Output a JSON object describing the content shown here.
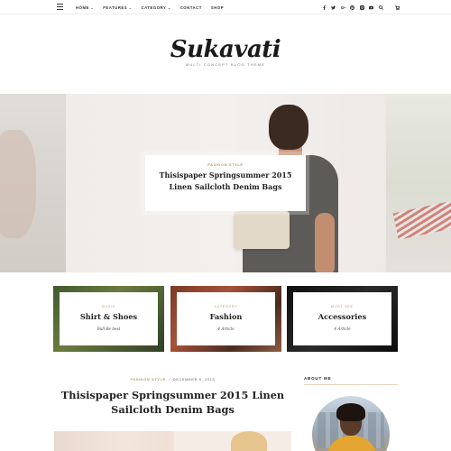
{
  "nav": {
    "items": [
      {
        "label": "Home",
        "has_dropdown": true
      },
      {
        "label": "Features",
        "has_dropdown": true
      },
      {
        "label": "Category",
        "has_dropdown": true
      },
      {
        "label": "Contact",
        "has_dropdown": false
      },
      {
        "label": "Shop",
        "has_dropdown": false
      }
    ],
    "caret": "⌄",
    "social_icons": [
      "facebook-icon",
      "twitter-icon",
      "google-plus-icon",
      "pinterest-icon",
      "instagram-icon",
      "youtube-icon",
      "search-icon"
    ],
    "cart_icon": "cart-icon"
  },
  "logo": {
    "name": "Sukavati",
    "tagline": "Multi Concept Blog Theme"
  },
  "hero": {
    "category": "Fashion Style",
    "title_line1": "Thisispaper Springsummer 2015",
    "title_line2": "Linen Sailcloth Denim Bags"
  },
  "categories": [
    {
      "label": "Music",
      "name": "Shirt & Shoes",
      "count": "Bull Be best"
    },
    {
      "label": "Category",
      "name": "Fashion",
      "count": "4 Article"
    },
    {
      "label": "Must See",
      "name": "Accessories",
      "count": "4 Article"
    }
  ],
  "post": {
    "category": "Fashion Style",
    "separator": "•",
    "date": "December 9, 2015",
    "title": "Thisispaper Springsummer 2015 Linen Sailcloth Denim Bags"
  },
  "sidebar": {
    "about_heading": "About Me"
  },
  "colors": {
    "accent_gold": "#b8955c",
    "text_dark": "#222222",
    "rule": "#e5d6ba"
  }
}
